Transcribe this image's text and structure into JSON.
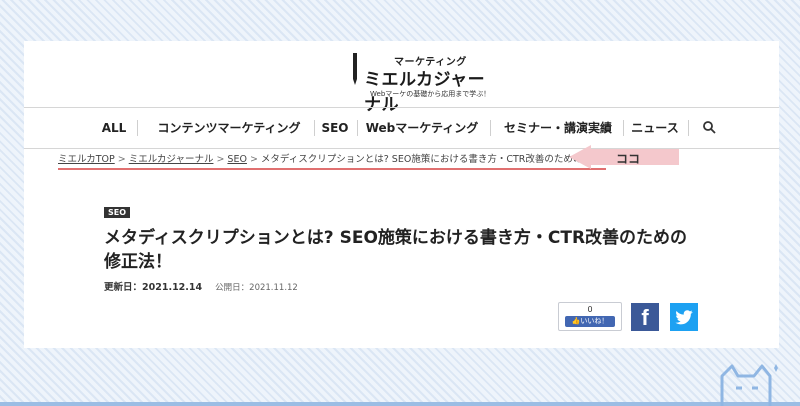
{
  "logo": {
    "top": "マーケティング",
    "main": "ミエルカジャーナル",
    "tagline": "Webマーケの基礎から応用まで学ぶ！"
  },
  "nav": {
    "items": [
      "ALL",
      "コンテンツマーケティング",
      "SEO",
      "Webマーケティング",
      "セミナー・講演実績",
      "ニュース"
    ],
    "search_icon": "search-icon"
  },
  "breadcrumb": {
    "items": [
      "ミエルカTOP",
      "ミエルカジャーナル",
      "SEO"
    ],
    "current": "メタディスクリプションとは? SEO施策における書き方・CTR改善のための修正法！",
    "separator": ">",
    "callout": "ココ"
  },
  "article": {
    "category": "SEO",
    "title": "メタディスクリプションとは? SEO施策における書き方・CTR改善のための修正法！",
    "updated_label": "更新日：",
    "updated": "2021.12.14",
    "published_label": "公開日：",
    "published": "2021.11.12"
  },
  "share": {
    "like_count": "0",
    "like_label": "いいね！",
    "facebook_icon": "f"
  },
  "colors": {
    "accent_underline": "#e07070",
    "callout_bg": "#f4c8cc",
    "facebook": "#3b5998",
    "twitter": "#1da1f2",
    "like": "#4267b2"
  }
}
